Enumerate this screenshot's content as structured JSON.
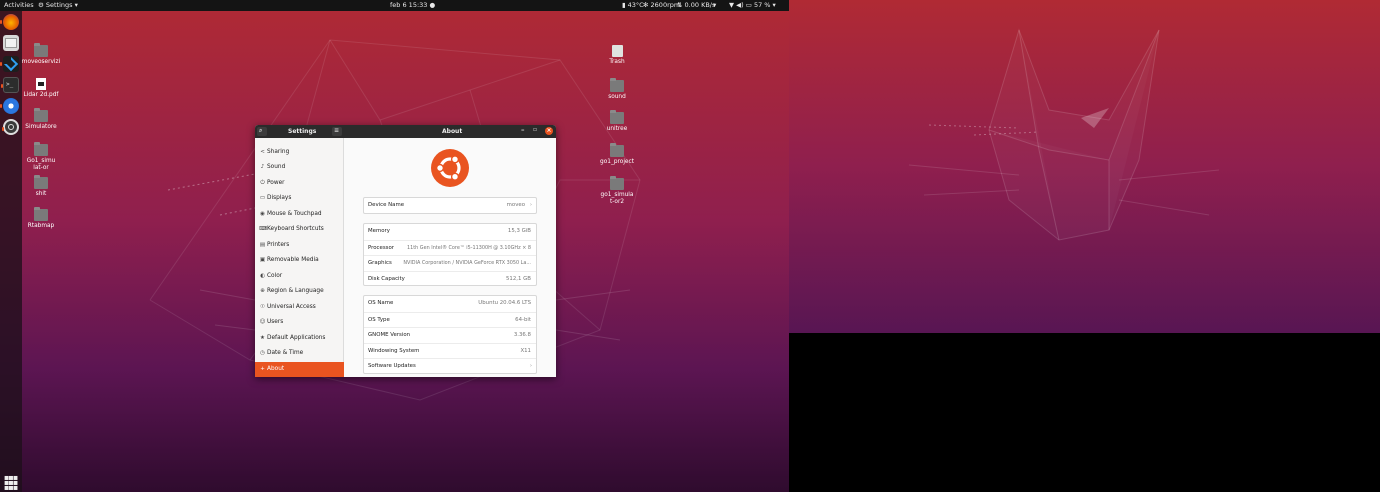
{
  "topbar": {
    "activities": "Activities",
    "app_menu": "Settings",
    "clock": "feb 6  15:33",
    "temp": "43°C",
    "fan": "2600rpm",
    "net": "0.00 KB/s",
    "battery": "57 %"
  },
  "dock": {
    "apps": [
      {
        "name": "firefox",
        "color": "#e66000"
      },
      {
        "name": "files",
        "color": "#d4d4d4"
      },
      {
        "name": "vscode",
        "color": "#2f7fd4"
      },
      {
        "name": "terminal",
        "color": "#333333"
      },
      {
        "name": "chromium",
        "color": "#3b8ae6"
      },
      {
        "name": "settings",
        "color": "#e8e8e8"
      }
    ],
    "grid_label": "⋮⋮⋮"
  },
  "desktop": {
    "left_icons": [
      {
        "label": "moveoservizi",
        "type": "folder"
      },
      {
        "label": "Lidar 2d.pdf",
        "type": "pdf"
      },
      {
        "label": "Simulatore",
        "type": "folder"
      },
      {
        "label": "Go1_simulat-or",
        "type": "folder"
      },
      {
        "label": "shit",
        "type": "folder"
      },
      {
        "label": "Rtabmap",
        "type": "folder"
      }
    ],
    "right_icons": [
      {
        "label": "Trash",
        "type": "trash"
      },
      {
        "label": "sound",
        "type": "folder"
      },
      {
        "label": "unitree",
        "type": "folder"
      },
      {
        "label": "go1_project",
        "type": "folder"
      },
      {
        "label": "go1_simulat-or2",
        "type": "folder"
      }
    ]
  },
  "window": {
    "sidebar_title": "Settings",
    "content_title": "About",
    "sidebar_items": [
      {
        "label": "Sharing",
        "icon": "share-icon",
        "glyph": "<"
      },
      {
        "label": "Sound",
        "icon": "sound-icon",
        "glyph": "♪"
      },
      {
        "label": "Power",
        "icon": "power-icon",
        "glyph": "⏻"
      },
      {
        "label": "Displays",
        "icon": "display-icon",
        "glyph": "▭"
      },
      {
        "label": "Mouse & Touchpad",
        "icon": "mouse-icon",
        "glyph": "◉"
      },
      {
        "label": "Keyboard Shortcuts",
        "icon": "keyboard-icon",
        "glyph": "⌨"
      },
      {
        "label": "Printers",
        "icon": "printer-icon",
        "glyph": "▤"
      },
      {
        "label": "Removable Media",
        "icon": "media-icon",
        "glyph": "▣"
      },
      {
        "label": "Color",
        "icon": "color-icon",
        "glyph": "◐"
      },
      {
        "label": "Region & Language",
        "icon": "globe-icon",
        "glyph": "⊕"
      },
      {
        "label": "Universal Access",
        "icon": "accessibility-icon",
        "glyph": "☉"
      },
      {
        "label": "Users",
        "icon": "users-icon",
        "glyph": "☺"
      },
      {
        "label": "Default Applications",
        "icon": "star-icon",
        "glyph": "★"
      },
      {
        "label": "Date & Time",
        "icon": "clock-icon",
        "glyph": "◷"
      },
      {
        "label": "About",
        "icon": "plus-icon",
        "glyph": "+"
      }
    ],
    "device_name": {
      "label": "Device Name",
      "value": "moveo"
    },
    "hardware": [
      {
        "label": "Memory",
        "value": "15,3 GiB"
      },
      {
        "label": "Processor",
        "value": "11th Gen Intel® Core™ i5-11300H @ 3.10GHz × 8"
      },
      {
        "label": "Graphics",
        "value": "NVIDIA Corporation / NVIDIA GeForce RTX 3050 La..."
      },
      {
        "label": "Disk Capacity",
        "value": "512,1 GB"
      }
    ],
    "os": [
      {
        "label": "OS Name",
        "value": "Ubuntu 20.04.6 LTS"
      },
      {
        "label": "OS Type",
        "value": "64-bit"
      },
      {
        "label": "GNOME Version",
        "value": "3.36.8"
      },
      {
        "label": "Windowing System",
        "value": "X11"
      },
      {
        "label": "Software Updates",
        "value": ""
      }
    ]
  },
  "colors": {
    "accent": "#e95420",
    "topbar": "#141414"
  }
}
